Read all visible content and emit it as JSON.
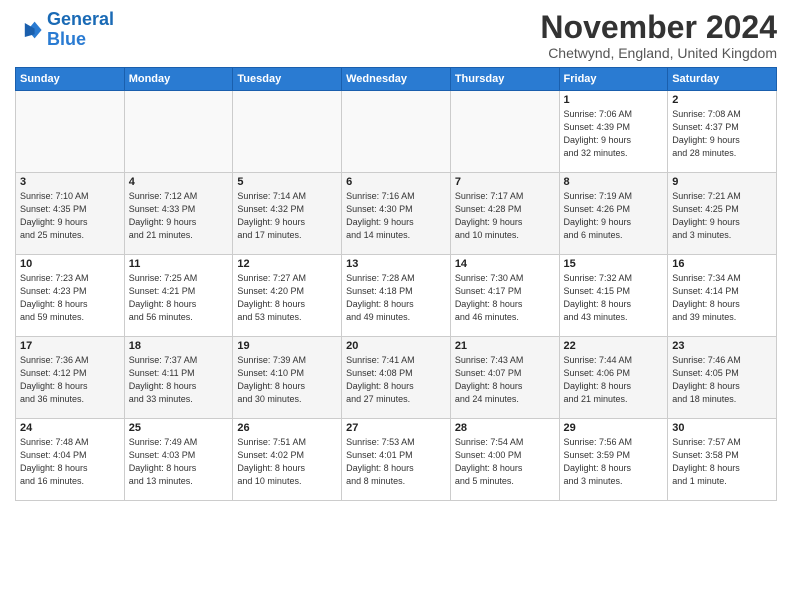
{
  "logo": {
    "line1": "General",
    "line2": "Blue"
  },
  "title": "November 2024",
  "location": "Chetwynd, England, United Kingdom",
  "headers": [
    "Sunday",
    "Monday",
    "Tuesday",
    "Wednesday",
    "Thursday",
    "Friday",
    "Saturday"
  ],
  "weeks": [
    [
      {
        "day": "",
        "info": ""
      },
      {
        "day": "",
        "info": ""
      },
      {
        "day": "",
        "info": ""
      },
      {
        "day": "",
        "info": ""
      },
      {
        "day": "",
        "info": ""
      },
      {
        "day": "1",
        "info": "Sunrise: 7:06 AM\nSunset: 4:39 PM\nDaylight: 9 hours\nand 32 minutes."
      },
      {
        "day": "2",
        "info": "Sunrise: 7:08 AM\nSunset: 4:37 PM\nDaylight: 9 hours\nand 28 minutes."
      }
    ],
    [
      {
        "day": "3",
        "info": "Sunrise: 7:10 AM\nSunset: 4:35 PM\nDaylight: 9 hours\nand 25 minutes."
      },
      {
        "day": "4",
        "info": "Sunrise: 7:12 AM\nSunset: 4:33 PM\nDaylight: 9 hours\nand 21 minutes."
      },
      {
        "day": "5",
        "info": "Sunrise: 7:14 AM\nSunset: 4:32 PM\nDaylight: 9 hours\nand 17 minutes."
      },
      {
        "day": "6",
        "info": "Sunrise: 7:16 AM\nSunset: 4:30 PM\nDaylight: 9 hours\nand 14 minutes."
      },
      {
        "day": "7",
        "info": "Sunrise: 7:17 AM\nSunset: 4:28 PM\nDaylight: 9 hours\nand 10 minutes."
      },
      {
        "day": "8",
        "info": "Sunrise: 7:19 AM\nSunset: 4:26 PM\nDaylight: 9 hours\nand 6 minutes."
      },
      {
        "day": "9",
        "info": "Sunrise: 7:21 AM\nSunset: 4:25 PM\nDaylight: 9 hours\nand 3 minutes."
      }
    ],
    [
      {
        "day": "10",
        "info": "Sunrise: 7:23 AM\nSunset: 4:23 PM\nDaylight: 8 hours\nand 59 minutes."
      },
      {
        "day": "11",
        "info": "Sunrise: 7:25 AM\nSunset: 4:21 PM\nDaylight: 8 hours\nand 56 minutes."
      },
      {
        "day": "12",
        "info": "Sunrise: 7:27 AM\nSunset: 4:20 PM\nDaylight: 8 hours\nand 53 minutes."
      },
      {
        "day": "13",
        "info": "Sunrise: 7:28 AM\nSunset: 4:18 PM\nDaylight: 8 hours\nand 49 minutes."
      },
      {
        "day": "14",
        "info": "Sunrise: 7:30 AM\nSunset: 4:17 PM\nDaylight: 8 hours\nand 46 minutes."
      },
      {
        "day": "15",
        "info": "Sunrise: 7:32 AM\nSunset: 4:15 PM\nDaylight: 8 hours\nand 43 minutes."
      },
      {
        "day": "16",
        "info": "Sunrise: 7:34 AM\nSunset: 4:14 PM\nDaylight: 8 hours\nand 39 minutes."
      }
    ],
    [
      {
        "day": "17",
        "info": "Sunrise: 7:36 AM\nSunset: 4:12 PM\nDaylight: 8 hours\nand 36 minutes."
      },
      {
        "day": "18",
        "info": "Sunrise: 7:37 AM\nSunset: 4:11 PM\nDaylight: 8 hours\nand 33 minutes."
      },
      {
        "day": "19",
        "info": "Sunrise: 7:39 AM\nSunset: 4:10 PM\nDaylight: 8 hours\nand 30 minutes."
      },
      {
        "day": "20",
        "info": "Sunrise: 7:41 AM\nSunset: 4:08 PM\nDaylight: 8 hours\nand 27 minutes."
      },
      {
        "day": "21",
        "info": "Sunrise: 7:43 AM\nSunset: 4:07 PM\nDaylight: 8 hours\nand 24 minutes."
      },
      {
        "day": "22",
        "info": "Sunrise: 7:44 AM\nSunset: 4:06 PM\nDaylight: 8 hours\nand 21 minutes."
      },
      {
        "day": "23",
        "info": "Sunrise: 7:46 AM\nSunset: 4:05 PM\nDaylight: 8 hours\nand 18 minutes."
      }
    ],
    [
      {
        "day": "24",
        "info": "Sunrise: 7:48 AM\nSunset: 4:04 PM\nDaylight: 8 hours\nand 16 minutes."
      },
      {
        "day": "25",
        "info": "Sunrise: 7:49 AM\nSunset: 4:03 PM\nDaylight: 8 hours\nand 13 minutes."
      },
      {
        "day": "26",
        "info": "Sunrise: 7:51 AM\nSunset: 4:02 PM\nDaylight: 8 hours\nand 10 minutes."
      },
      {
        "day": "27",
        "info": "Sunrise: 7:53 AM\nSunset: 4:01 PM\nDaylight: 8 hours\nand 8 minutes."
      },
      {
        "day": "28",
        "info": "Sunrise: 7:54 AM\nSunset: 4:00 PM\nDaylight: 8 hours\nand 5 minutes."
      },
      {
        "day": "29",
        "info": "Sunrise: 7:56 AM\nSunset: 3:59 PM\nDaylight: 8 hours\nand 3 minutes."
      },
      {
        "day": "30",
        "info": "Sunrise: 7:57 AM\nSunset: 3:58 PM\nDaylight: 8 hours\nand 1 minute."
      }
    ]
  ]
}
